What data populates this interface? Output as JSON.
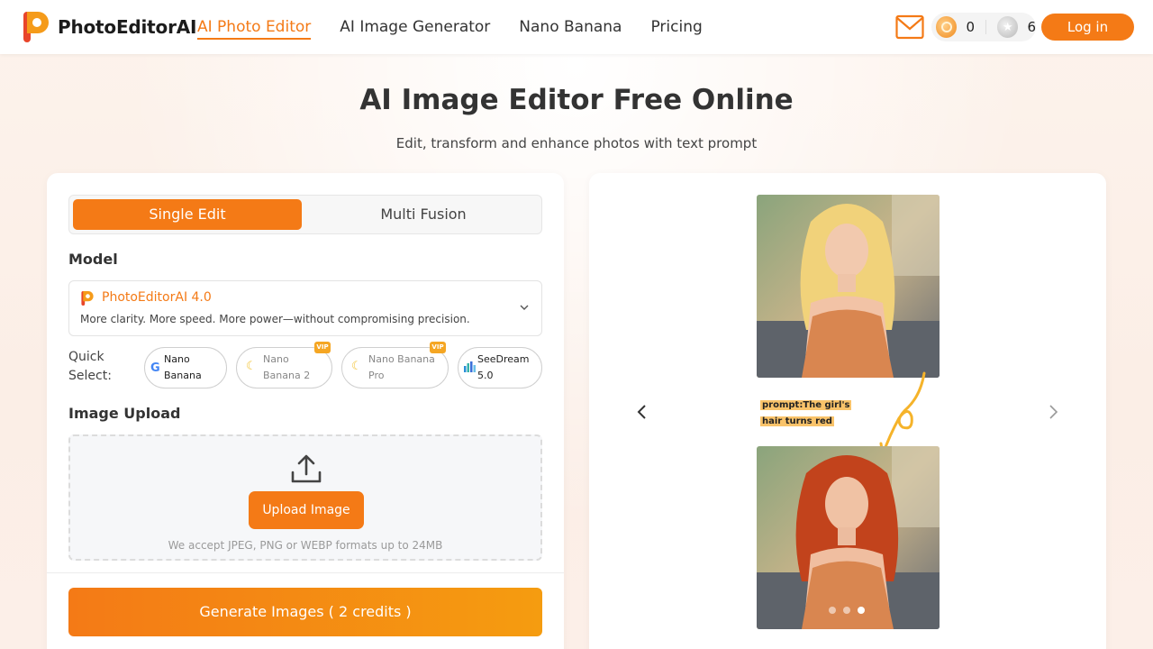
{
  "header": {
    "brand": "PhotoEditorAI",
    "nav": [
      {
        "label": "AI Photo Editor",
        "active": true
      },
      {
        "label": "AI Image Generator",
        "active": false
      },
      {
        "label": "Nano Banana",
        "active": false
      },
      {
        "label": "Pricing",
        "active": false
      }
    ],
    "credits_gold": "0",
    "credits_silver": "6",
    "login_label": "Log in",
    "accent": "#f47a16"
  },
  "hero": {
    "title": "AI Image Editor Free Online",
    "subtitle": "Edit, transform and enhance photos with text prompt"
  },
  "editor": {
    "tabs": [
      "Single Edit",
      "Multi Fusion"
    ],
    "model_label": "Model",
    "model": {
      "name": "PhotoEditorAI 4.0",
      "description": "More clarity. More speed. More power—without compromising precision."
    },
    "quick_select_label": "Quick Select:",
    "quick_select": [
      {
        "line1": "Nano",
        "line2": "Banana",
        "icon": "google-icon",
        "vip": false
      },
      {
        "line1": "Nano",
        "line2": "Banana 2",
        "icon": "banana-icon",
        "vip": true
      },
      {
        "line1": "Nano Banana",
        "line2": "Pro",
        "icon": "banana-icon",
        "vip": true
      },
      {
        "line1": "SeeDream",
        "line2": "5.0",
        "icon": "seedream-icon",
        "vip": false
      }
    ],
    "vip_label": "VIP",
    "upload_label": "Image Upload",
    "upload_button": "Upload Image",
    "upload_note": "We accept JPEG, PNG or WEBP formats up to 24MB",
    "generate_button": "Generate Images ( 2 credits )"
  },
  "preview": {
    "prompt_line1": "prompt:The girl's",
    "prompt_line2": "hair turns red",
    "slides": 3,
    "active_slide": 3
  }
}
